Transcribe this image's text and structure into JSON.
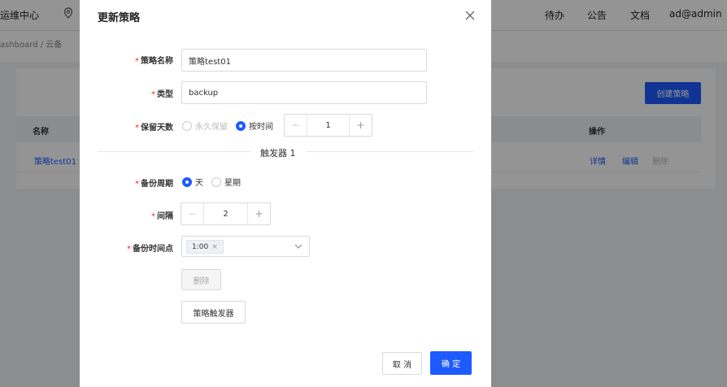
{
  "background": {
    "brand": "运维中心",
    "nav": [
      "待办",
      "公告",
      "文档",
      "ad@admin"
    ],
    "breadcrumb": "ashboard / 云备",
    "create_button": "创建策略",
    "table": {
      "headers": [
        "名称",
        "操作"
      ],
      "row": {
        "name": "策略test01",
        "actions": [
          "详情",
          "编辑",
          "删除"
        ]
      }
    }
  },
  "modal": {
    "title": "更新策略",
    "form": {
      "name_label": "策略名称",
      "name_value": "策略test01",
      "type_label": "类型",
      "type_value": "backup",
      "retention_label": "保留天数",
      "retention_options": [
        "永久保留",
        "按时间"
      ],
      "retention_selected": "按时间",
      "retention_value": "1",
      "minus": "−",
      "plus": "+"
    },
    "trigger": {
      "divider_label": "触发器 1",
      "cycle_label": "备份周期",
      "cycle_options": [
        "天",
        "星期"
      ],
      "cycle_selected": "天",
      "interval_label": "间隔",
      "interval_value": "2",
      "time_label": "备份时间点",
      "time_tags": [
        "1:00"
      ],
      "tag_close": "×",
      "delete_button": "删除"
    },
    "add_trigger_button": "策略触发器",
    "footer": {
      "cancel": "取 消",
      "confirm": "确 定"
    }
  },
  "colors": {
    "primary": "#1d5bff",
    "required": "#f5222d"
  }
}
